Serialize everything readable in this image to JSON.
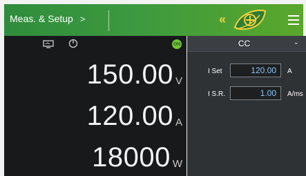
{
  "header": {
    "breadcrumb_label": "Meas. & Setup",
    "breadcrumb_chevron": ">",
    "collapse_glyph": "«"
  },
  "status": {
    "on_badge": "ON"
  },
  "measurements": [
    {
      "value": "150.00",
      "unit": "V"
    },
    {
      "value": "120.00",
      "unit": "A"
    },
    {
      "value": "18000",
      "unit": "W"
    }
  ],
  "setup": {
    "mode": "CC",
    "params": [
      {
        "name": "I Set",
        "value": "120.00",
        "unit": "A"
      },
      {
        "name": "I S.R.",
        "value": "1.00",
        "unit": "A/ms"
      }
    ]
  },
  "colors": {
    "header_green": "#3d9a3f",
    "accent_yellow": "#f4d23e",
    "on_green": "#6fc43a",
    "value_blue": "#8fc8ff"
  }
}
